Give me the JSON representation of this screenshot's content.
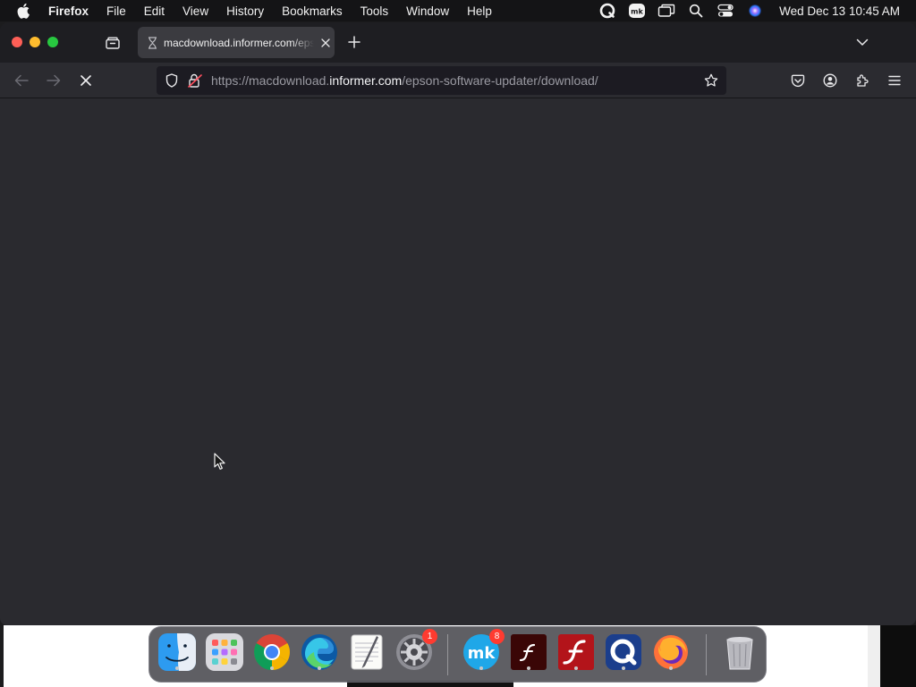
{
  "menubar": {
    "app_name": "Firefox",
    "items": [
      "File",
      "Edit",
      "View",
      "History",
      "Bookmarks",
      "Tools",
      "Window",
      "Help"
    ],
    "clock": "Wed Dec 13  10:45 AM"
  },
  "browser": {
    "tab": {
      "title": "macdownload.informer.com/epson-software-updater/download/"
    },
    "url": {
      "prefix": "https://macdownload.",
      "host": "informer.com",
      "path": "/epson-software-updater/download/"
    }
  },
  "dock": {
    "apps": [
      {
        "name": "Finder",
        "badge": ""
      },
      {
        "name": "Launchpad",
        "badge": ""
      },
      {
        "name": "Google Chrome",
        "badge": ""
      },
      {
        "name": "Microsoft Edge",
        "badge": ""
      },
      {
        "name": "TextEdit",
        "badge": ""
      },
      {
        "name": "System Settings",
        "badge": "1"
      },
      {
        "name": "MacKeeper",
        "badge": "8"
      },
      {
        "name": "Flash Player",
        "badge": ""
      },
      {
        "name": "Flash Player Install Manager",
        "badge": ""
      },
      {
        "name": "QuickTime",
        "badge": ""
      },
      {
        "name": "Firefox",
        "badge": ""
      },
      {
        "name": "Trash",
        "badge": ""
      }
    ]
  },
  "colors": {
    "content_bg": "#2a2a2f",
    "close": "#fe5f57",
    "minimize": "#febc2e",
    "maximize": "#28c840",
    "badge": "#ff3b30"
  }
}
